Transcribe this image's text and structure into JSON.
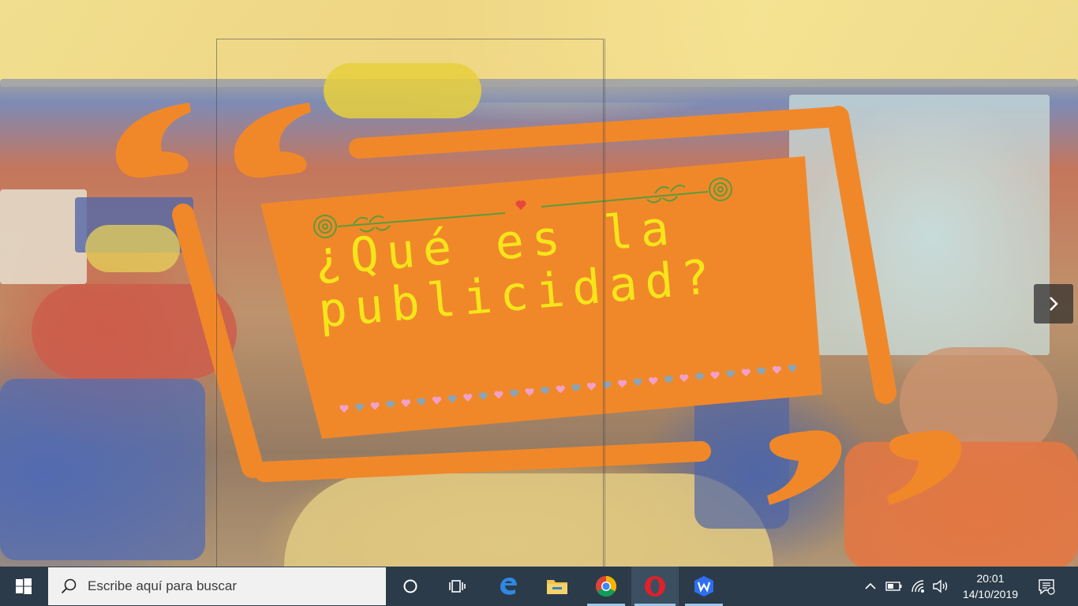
{
  "slide": {
    "title_line1": "¿Qué es la",
    "title_line2": "publicidad?"
  },
  "colors": {
    "accent": "#f0882a",
    "title_text": "#f5e51a",
    "ornament_green": "#5b9b3a",
    "taskbar": "#2b3b4a"
  },
  "taskbar": {
    "search_placeholder": "Escribe aquí para buscar",
    "apps": [
      "cortana-icon",
      "task-view-icon",
      "edge-icon",
      "file-explorer-icon",
      "chrome-icon",
      "opera-icon",
      "wps-icon"
    ],
    "clock": {
      "time": "20:01",
      "date": "14/10/2019"
    }
  }
}
